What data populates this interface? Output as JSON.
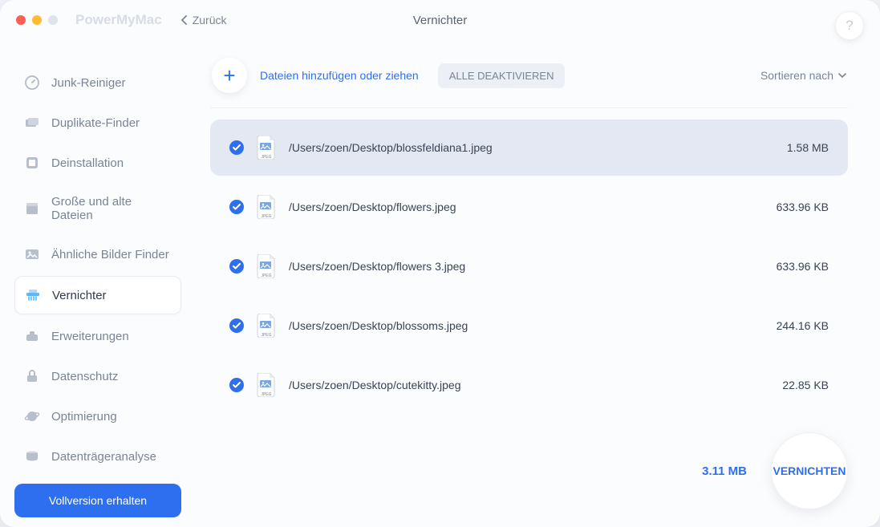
{
  "app_title": "PowerMyMac",
  "back": "Zurück",
  "page_title": "Vernichter",
  "help": "?",
  "sidebar": {
    "items": [
      {
        "label": "Junk-Reiniger",
        "icon": "gauge"
      },
      {
        "label": "Duplikate-Finder",
        "icon": "folders"
      },
      {
        "label": "Deinstallation",
        "icon": "app"
      },
      {
        "label": "Große und alte Dateien",
        "icon": "box"
      },
      {
        "label": "Ähnliche Bilder Finder",
        "icon": "image"
      },
      {
        "label": "Vernichter",
        "icon": "shredder"
      },
      {
        "label": "Erweiterungen",
        "icon": "puzzle"
      },
      {
        "label": "Datenschutz",
        "icon": "lock"
      },
      {
        "label": "Optimierung",
        "icon": "planet"
      },
      {
        "label": "Datenträgeranalyse",
        "icon": "disk"
      }
    ],
    "fullversion": "Vollversion erhalten",
    "active_index": 5
  },
  "toolbar": {
    "add_hint": "Dateien hinzufügen oder ziehen",
    "deactivate_all": "ALLE DEAKTIVIEREN",
    "sort": "Sortieren nach"
  },
  "files": [
    {
      "checked": true,
      "path": "/Users/zoen/Desktop/blossfeldiana1.jpeg",
      "size": "1.58 MB",
      "selected": true
    },
    {
      "checked": true,
      "path": "/Users/zoen/Desktop/flowers.jpeg",
      "size": "633.96 KB",
      "selected": false
    },
    {
      "checked": true,
      "path": "/Users/zoen/Desktop/flowers 3.jpeg",
      "size": "633.96 KB",
      "selected": false
    },
    {
      "checked": true,
      "path": "/Users/zoen/Desktop/blossoms.jpeg",
      "size": "244.16 KB",
      "selected": false
    },
    {
      "checked": true,
      "path": "/Users/zoen/Desktop/cutekitty.jpeg",
      "size": "22.85 KB",
      "selected": false
    }
  ],
  "footer": {
    "total": "3.11 MB",
    "action": "VERNICHTEN"
  }
}
